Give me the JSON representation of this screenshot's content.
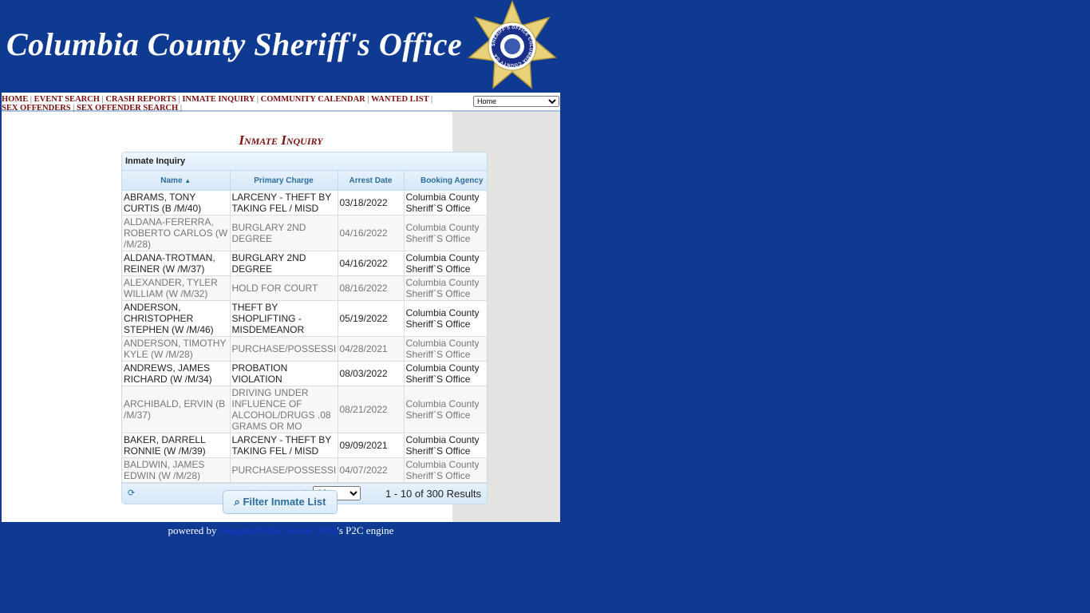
{
  "banner": {
    "title": "Columbia County Sheriff's Office",
    "badge_text": "SHERIFF'S OFFICE COLUMBIA COUNTY GA"
  },
  "nav": {
    "links": [
      "HOME",
      "EVENT SEARCH",
      "CRASH REPORTS",
      "INMATE INQUIRY",
      "COMMUNITY CALENDAR",
      "WANTED LIST",
      "SEX OFFENDERS",
      "SEX OFFENDER SEARCH"
    ],
    "select_value": "Home"
  },
  "page_title": "Inmate Inquiry",
  "grid": {
    "caption": "Inmate Inquiry",
    "columns": [
      "Name",
      "Primary Charge",
      "Arrest Date",
      "Booking Agency"
    ],
    "sort_icon": "sort-asc-icon",
    "rows": [
      [
        "ABRAMS, TONY CURTIS (B /M/40)",
        "LARCENY - THEFT BY TAKING FEL / MISD",
        "03/18/2022",
        "Columbia County Sheriff`S Office"
      ],
      [
        "ALDANA-FERERRA, ROBERTO CARLOS (W /M/28)",
        "BURGLARY 2ND DEGREE",
        "04/16/2022",
        "Columbia County Sheriff`S Office"
      ],
      [
        "ALDANA-TROTMAN, REINER (W /M/37)",
        "BURGLARY 2ND DEGREE",
        "04/16/2022",
        "Columbia County Sheriff`S Office"
      ],
      [
        "ALEXANDER, TYLER WILLIAM (W /M/32)",
        "HOLD FOR COURT",
        "08/16/2022",
        "Columbia County Sheriff`S Office"
      ],
      [
        "ANDERSON, CHRISTOPHER STEPHEN (W /M/46)",
        "THEFT BY SHOPLIFTING - MISDEMEANOR",
        "05/19/2022",
        "Columbia County Sheriff`S Office"
      ],
      [
        "ANDERSON, TIMOTHY KYLE (W /M/28)",
        "PURCHASE/POSSESSI",
        "04/28/2021",
        "Columbia County Sheriff`S Office"
      ],
      [
        "ANDREWS, JAMES RICHARD (W /M/34)",
        "PROBATION VIOLATION",
        "08/03/2022",
        "Columbia County Sheriff`S Office"
      ],
      [
        "ARCHIBALD, ERVIN (B /M/37)",
        "DRIVING UNDER INFLUENCE OF ALCOHOL/DRUGS .08 GRAMS OR MO",
        "08/21/2022",
        "Columbia County Sheriff`S Office"
      ],
      [
        "BAKER, DARRELL RONNIE (W /M/39)",
        "LARCENY - THEFT BY TAKING FEL / MISD",
        "09/09/2021",
        "Columbia County Sheriff`S Office"
      ],
      [
        "BALDWIN, JAMES EDWIN (W /M/28)",
        "PURCHASE/POSSESSI",
        "04/07/2022",
        "Columbia County Sheriff`S Office"
      ]
    ]
  },
  "pager": {
    "page_size": "10",
    "results": "1 - 10 of 300 Results"
  },
  "filter_button": "Filter Inmate List",
  "footer": {
    "prefix": "powered by",
    "link": "Sungard Public Sector OSSI",
    "suffix": "'s P2C engine"
  }
}
